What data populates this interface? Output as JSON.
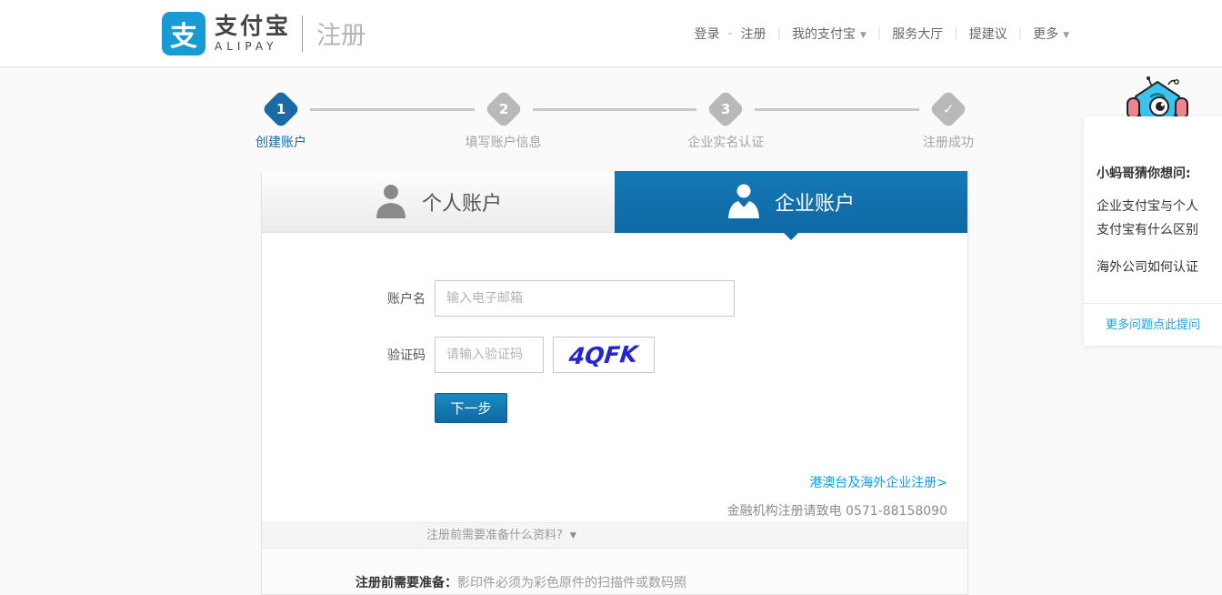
{
  "header": {
    "logo_mark": "支",
    "brand_cn": "支付宝",
    "brand_en": "ALIPAY",
    "page_title": "注册",
    "nav": {
      "login": "登录",
      "dash": "-",
      "register": "注册",
      "my_alipay": "我的支付宝",
      "service_hall": "服务大厅",
      "suggestion": "提建议",
      "more": "更多",
      "caret": "▼"
    }
  },
  "steps": {
    "items": [
      {
        "num": "1",
        "label": "创建账户"
      },
      {
        "num": "2",
        "label": "填写账户信息"
      },
      {
        "num": "3",
        "label": "企业实名认证"
      },
      {
        "num": "✓",
        "label": "注册成功"
      }
    ]
  },
  "tabs": {
    "personal": "个人账户",
    "enterprise": "企业账户"
  },
  "form": {
    "account_label": "账户名",
    "account_placeholder": "输入电子邮箱",
    "captcha_label": "验证码",
    "captcha_placeholder": "请输入验证码",
    "captcha_value": "4QFK",
    "next_button": "下一步"
  },
  "links": {
    "overseas": "港澳台及海外企业注册>",
    "finance": "金融机构注册请致电 0571-88158090"
  },
  "prep": {
    "toggle": "注册前需要准备什么资料?",
    "toggle_caret": "▼",
    "note_bold": "注册前需要准备：",
    "note_rest": "影印件必须为彩色原件的扫描件或数码照"
  },
  "sidebar": {
    "title": "小蚂哥猜你想问:",
    "question1": "企业支付宝与个人支付宝有什么区别",
    "question2": "海外公司如何认证",
    "more_link": "更多问题点此提问"
  },
  "colors": {
    "tab_blue_top": "#1579b6",
    "tab_blue_bottom": "#0d68a4",
    "step_active_blue": "#1a6aa6",
    "link_blue": "#0aa0e0",
    "captcha_ink": "#2324d8",
    "logo_blue": "#169bd5"
  }
}
